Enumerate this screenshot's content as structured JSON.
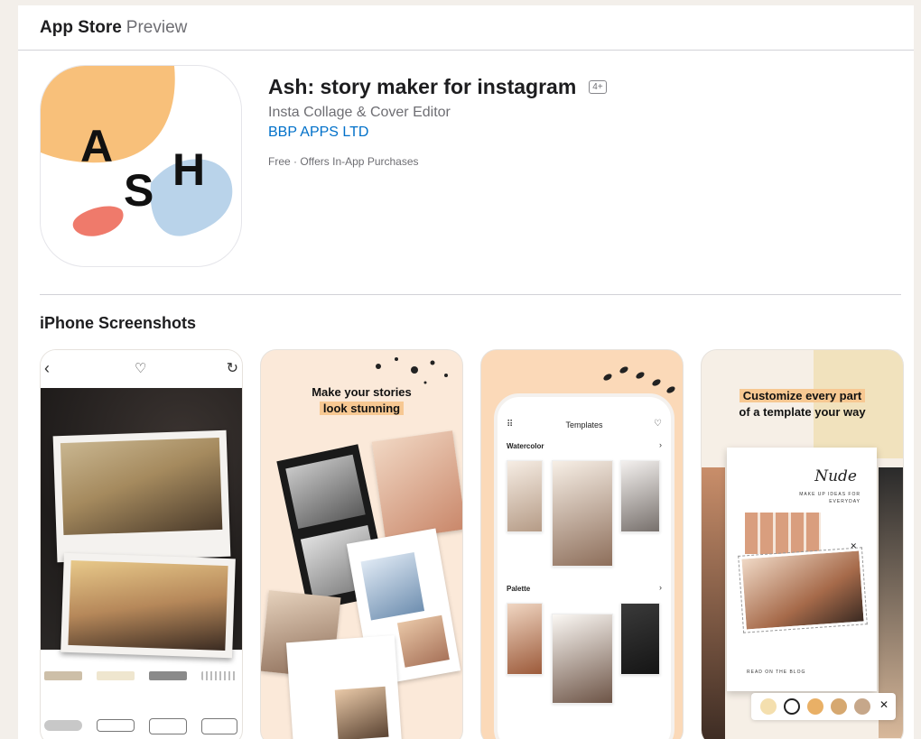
{
  "header": {
    "brand": "App Store",
    "brand_sub": "Preview"
  },
  "app": {
    "title": "Ash: story maker for instagram",
    "age_rating": "4+",
    "subtitle": "Insta Collage & Cover Editor",
    "developer": "BBP APPS LTD",
    "price_line": "Free · Offers In-App Purchases",
    "icon_letters": [
      "A",
      "S",
      "H"
    ]
  },
  "screenshots": {
    "title": "iPhone Screenshots",
    "shot2": {
      "line1": "Make your stories",
      "line2": "look stunning"
    },
    "shot3": {
      "screen_title": "Templates",
      "section1": "Watercolor",
      "section2": "Palette"
    },
    "shot4": {
      "line1": "Customize every part",
      "line2": "of a template your way",
      "poster_title": "Nude",
      "poster_tag": "MAKE UP IDEAS FOR EVERYDAY",
      "poster_footer": "READ ON THE BLOG"
    }
  },
  "colors": {
    "link": "#0070c9",
    "highlight": "#f7c892",
    "icon_orange": "#f8c07a",
    "icon_red": "#ef7a6b",
    "icon_blue": "#b9d3ea"
  }
}
